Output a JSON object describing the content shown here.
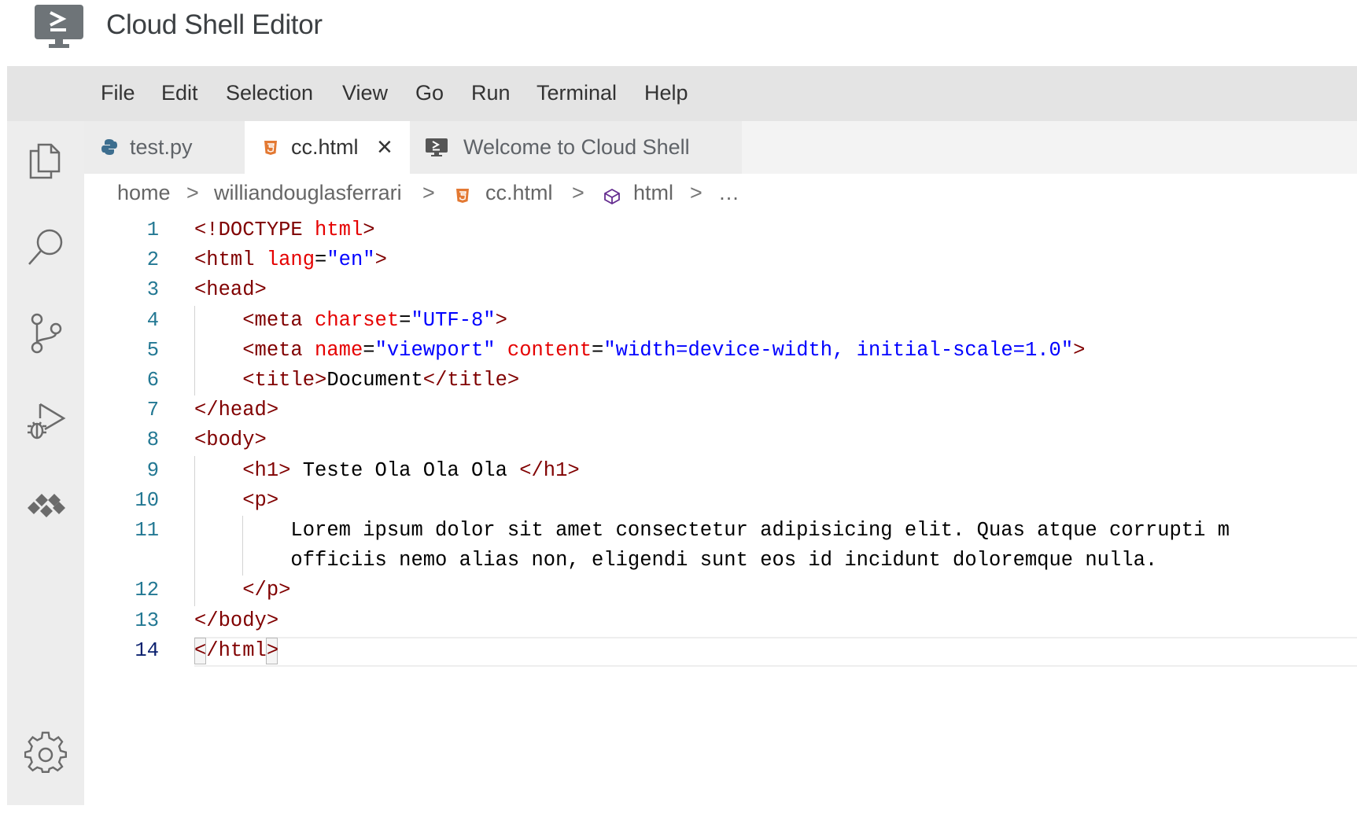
{
  "app": {
    "title": "Cloud Shell Editor",
    "icon": "cloud-shell-terminal-icon"
  },
  "menu": [
    "File",
    "Edit",
    "Selection",
    "View",
    "Go",
    "Run",
    "Terminal",
    "Help"
  ],
  "activity_bar": {
    "icons": [
      "explorer-icon",
      "search-icon",
      "source-control-icon",
      "run-debug-icon",
      "cloud-code-icon",
      "settings-gear-icon"
    ]
  },
  "tabs": [
    {
      "label": "test.py",
      "icon": "python-file-icon",
      "active": false
    },
    {
      "label": "cc.html",
      "icon": "html-file-icon",
      "active": true,
      "close": "×"
    },
    {
      "label": "Welcome to Cloud Shell",
      "icon": "cloud-shell-tab-icon",
      "active": false
    }
  ],
  "breadcrumb": {
    "items": [
      "home",
      "williandouglasferrari",
      "cc.html",
      "html",
      "…"
    ],
    "separator": ">"
  },
  "editor": {
    "current_line": 14,
    "line_numbers": [
      "1",
      "2",
      "3",
      "4",
      "5",
      "6",
      "7",
      "8",
      "9",
      "10",
      "11",
      "",
      "12",
      "13",
      "14"
    ],
    "lines": [
      [
        {
          "t": "<!DOCTYPE ",
          "c": "tag"
        },
        {
          "t": "html",
          "c": "attr"
        },
        {
          "t": ">",
          "c": "tag"
        }
      ],
      [
        {
          "t": "<html ",
          "c": "tag"
        },
        {
          "t": "lang",
          "c": "attr"
        },
        {
          "t": "=",
          "c": "plain"
        },
        {
          "t": "\"en\"",
          "c": "str"
        },
        {
          "t": ">",
          "c": "tag"
        }
      ],
      [
        {
          "t": "<head>",
          "c": "tag"
        }
      ],
      [
        {
          "t": "    "
        },
        {
          "t": "<meta ",
          "c": "tag"
        },
        {
          "t": "charset",
          "c": "attr"
        },
        {
          "t": "=",
          "c": "plain"
        },
        {
          "t": "\"UTF-8\"",
          "c": "str"
        },
        {
          "t": ">",
          "c": "tag"
        }
      ],
      [
        {
          "t": "    "
        },
        {
          "t": "<meta ",
          "c": "tag"
        },
        {
          "t": "name",
          "c": "attr"
        },
        {
          "t": "=",
          "c": "plain"
        },
        {
          "t": "\"viewport\"",
          "c": "str"
        },
        {
          "t": " "
        },
        {
          "t": "content",
          "c": "attr"
        },
        {
          "t": "=",
          "c": "plain"
        },
        {
          "t": "\"width=device-width, initial-scale=1.0\"",
          "c": "str"
        },
        {
          "t": ">",
          "c": "tag"
        }
      ],
      [
        {
          "t": "    "
        },
        {
          "t": "<title>",
          "c": "tag"
        },
        {
          "t": "Document",
          "c": "plain"
        },
        {
          "t": "</title>",
          "c": "tag"
        }
      ],
      [
        {
          "t": "</head>",
          "c": "tag"
        }
      ],
      [
        {
          "t": "<body>",
          "c": "tag"
        }
      ],
      [
        {
          "t": "    "
        },
        {
          "t": "<h1>",
          "c": "tag"
        },
        {
          "t": " Teste Ola Ola Ola ",
          "c": "plain"
        },
        {
          "t": "</h1>",
          "c": "tag"
        }
      ],
      [
        {
          "t": "    "
        },
        {
          "t": "<p>",
          "c": "tag"
        }
      ],
      [
        {
          "t": "        Lorem ipsum dolor sit amet consectetur adipisicing elit. Quas atque corrupti m",
          "c": "plain"
        }
      ],
      [
        {
          "t": "        officiis nemo alias non, eligendi sunt eos id incidunt doloremque nulla.",
          "c": "plain"
        }
      ],
      [
        {
          "t": "    "
        },
        {
          "t": "</p>",
          "c": "tag"
        }
      ],
      [
        {
          "t": "</body>",
          "c": "tag"
        }
      ],
      [
        {
          "t": "</html>",
          "c": "tag"
        }
      ]
    ]
  }
}
